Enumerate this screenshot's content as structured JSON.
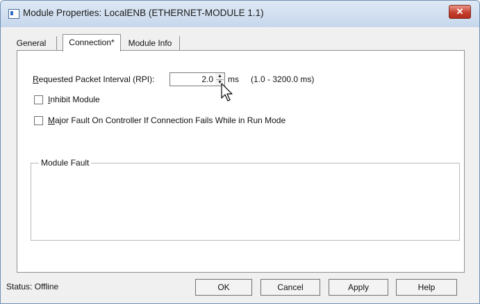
{
  "window": {
    "title": "Module Properties: LocalENB (ETHERNET-MODULE 1.1)",
    "close_glyph": "✕"
  },
  "tabs": [
    {
      "label": "General",
      "active": false
    },
    {
      "label": "Connection*",
      "active": true
    },
    {
      "label": "Module Info",
      "active": false
    }
  ],
  "connection": {
    "rpi_label_ul": "R",
    "rpi_label_rest": "equested Packet Interval (RPI):",
    "rpi_value": "2.0",
    "rpi_unit": "ms",
    "rpi_range": "(1.0 - 3200.0 ms)",
    "inhibit": {
      "ul": "I",
      "rest": "nhibit Module",
      "checked": false
    },
    "major_fault": {
      "ul": "M",
      "rest": "ajor Fault On Controller If Connection Fails While in Run Mode",
      "checked": false
    },
    "module_fault_label": "Module Fault"
  },
  "footer": {
    "status_label": "Status:",
    "status_value": "Offline",
    "ok_label": "OK",
    "cancel_label": "Cancel",
    "apply_label": "Apply",
    "help_label": "Help"
  },
  "colors": {
    "title_gradient_top": "#dfe9f5",
    "title_gradient_bottom": "#c6d7ec",
    "close_button": "#c6402f",
    "panel_background": "#ffffff",
    "dialog_background": "#f0f0f0"
  },
  "icons": {
    "app": "window-app-icon",
    "close": "close-icon",
    "spin_up": "spin-up-icon",
    "spin_down": "spin-down-icon",
    "cursor": "mouse-pointer-icon"
  }
}
